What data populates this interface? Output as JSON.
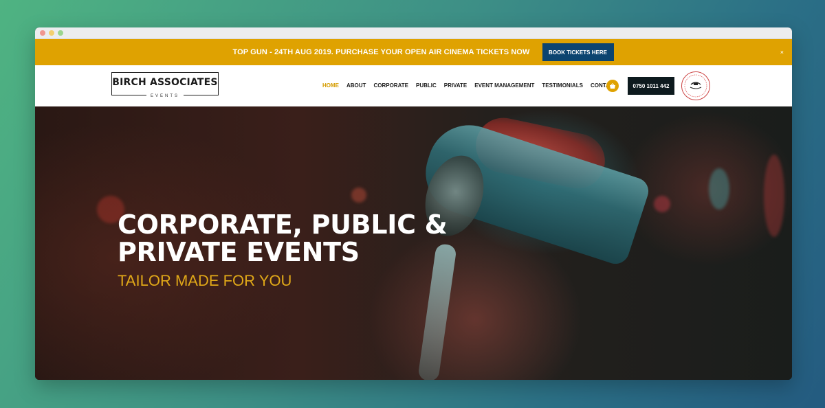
{
  "promo": {
    "text": "TOP GUN - 24TH AUG 2019. PURCHASE YOUR OPEN AIR CINEMA TICKETS NOW",
    "button_label": "BOOK TICKETS HERE",
    "close_label": "×",
    "color": "#dfa201",
    "button_color": "#0c4470"
  },
  "header": {
    "logo_main": "BIRCH ASSOCIATES",
    "logo_sub": "EVENTS",
    "menu": [
      {
        "label": "HOME",
        "active": true
      },
      {
        "label": "ABOUT"
      },
      {
        "label": "CORPORATE"
      },
      {
        "label": "PUBLIC"
      },
      {
        "label": "PRIVATE"
      },
      {
        "label": "EVENT MANAGEMENT"
      },
      {
        "label": "TESTIMONIALS"
      },
      {
        "label": "CONTACT"
      }
    ],
    "cart_icon": "basket-icon",
    "phone": "0750 1011 442",
    "badge_icon": "partner-logo-icon"
  },
  "hero": {
    "title": "CORPORATE, PUBLIC & PRIVATE EVENTS",
    "subtitle": "TAILOR MADE FOR YOU",
    "accent_color": "#e0a818"
  }
}
